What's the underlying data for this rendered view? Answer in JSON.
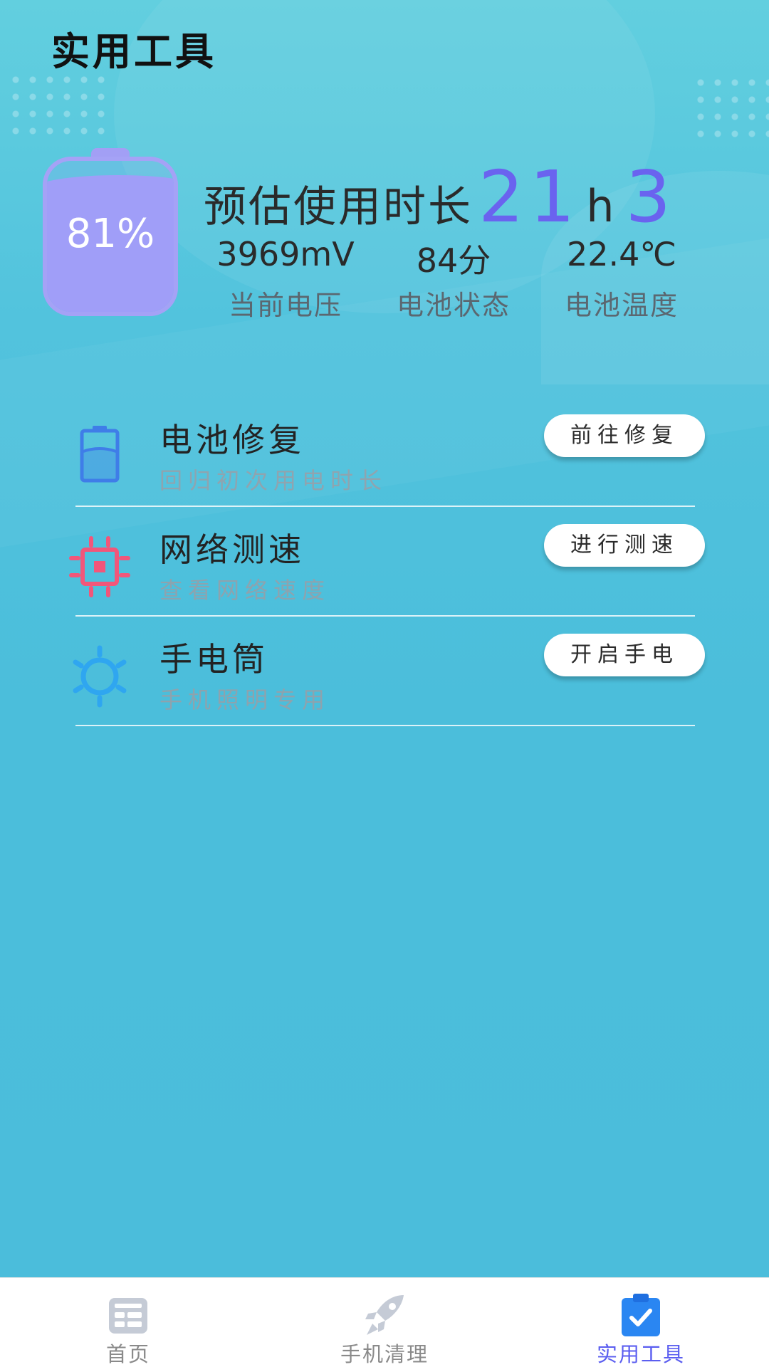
{
  "page_title": "实用工具",
  "battery": {
    "level_percent": 81,
    "percent_text": "81%",
    "estimate_label": "预估使用时长",
    "estimate_hours": "21",
    "estimate_hours_unit": "h",
    "estimate_minutes": "3",
    "stats": [
      {
        "value": "3969mV",
        "label": "当前电压"
      },
      {
        "value": "84分",
        "label": "电池状态"
      },
      {
        "value": "22.4℃",
        "label": "电池温度"
      }
    ]
  },
  "tools": [
    {
      "icon": "battery-outline-icon",
      "title": "电池修复",
      "subtitle": "回归初次用电时长",
      "button": "前往修复",
      "icon_color": "#3f7de8"
    },
    {
      "icon": "chip-icon",
      "title": "网络测速",
      "subtitle": "查看网络速度",
      "button": "进行测速",
      "icon_color": "#f2567a"
    },
    {
      "icon": "sun-icon",
      "title": "手电筒",
      "subtitle": "手机照明专用",
      "button": "开启手电",
      "icon_color": "#2fa6f0"
    }
  ],
  "bottom_nav": [
    {
      "label": "首页",
      "icon": "dashboard-icon",
      "active": false
    },
    {
      "label": "手机清理",
      "icon": "rocket-icon",
      "active": false
    },
    {
      "label": "实用工具",
      "icon": "clipboard-check-icon",
      "active": true
    }
  ],
  "colors": {
    "accent": "#6a63ef",
    "battery": "#a09ef8",
    "background": "#4bbedb",
    "nav_active": "#5b5ef0",
    "nav_inactive": "#8a8a8a"
  }
}
